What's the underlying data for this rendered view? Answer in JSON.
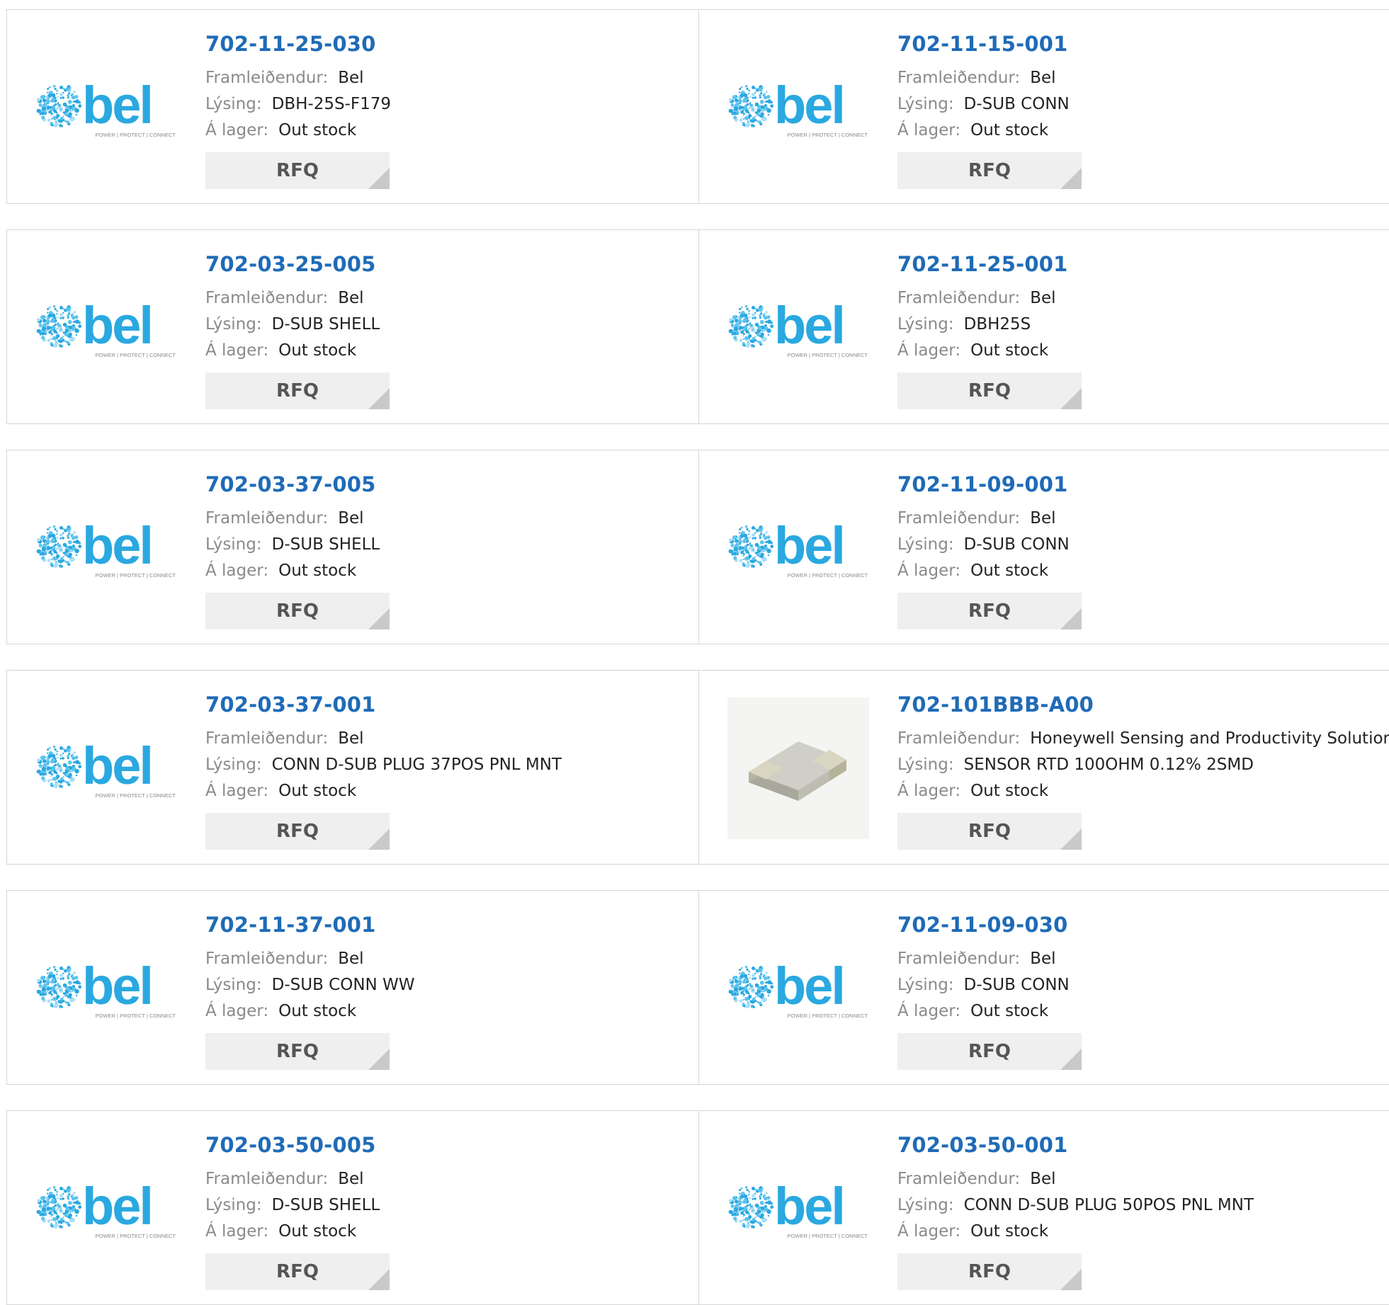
{
  "labels": {
    "manufacturer": "Framleiðendur:",
    "description": "Lýsing:",
    "stock": "Á lager:",
    "rfq": "RFQ"
  },
  "logo": {
    "text": "bel",
    "tagline": "POWER | PROTECT | CONNECT",
    "color": "#2aa8e0"
  },
  "colors": {
    "part_number": "#1f6bb7",
    "label": "#8a8a8a",
    "rfq_bg": "#efefef"
  },
  "products": [
    {
      "part_number": "702-11-25-030",
      "manufacturer": "Bel",
      "description": "DBH-25S-F179",
      "stock": "Out stock",
      "image": "bel-logo"
    },
    {
      "part_number": "702-11-15-001",
      "manufacturer": "Bel",
      "description": "D-SUB CONN",
      "stock": "Out stock",
      "image": "bel-logo"
    },
    {
      "part_number": "702-03-25-005",
      "manufacturer": "Bel",
      "description": "D-SUB SHELL",
      "stock": "Out stock",
      "image": "bel-logo"
    },
    {
      "part_number": "702-11-25-001",
      "manufacturer": "Bel",
      "description": "DBH25S",
      "stock": "Out stock",
      "image": "bel-logo"
    },
    {
      "part_number": "702-03-37-005",
      "manufacturer": "Bel",
      "description": "D-SUB SHELL",
      "stock": "Out stock",
      "image": "bel-logo"
    },
    {
      "part_number": "702-11-09-001",
      "manufacturer": "Bel",
      "description": "D-SUB CONN",
      "stock": "Out stock",
      "image": "bel-logo"
    },
    {
      "part_number": "702-03-37-001",
      "manufacturer": "Bel",
      "description": "CONN D-SUB PLUG 37POS PNL MNT",
      "stock": "Out stock",
      "image": "bel-logo"
    },
    {
      "part_number": "702-101BBB-A00",
      "manufacturer": "Honeywell Sensing and Productivity Solutions",
      "description": "SENSOR RTD 100OHM 0.12% 2SMD",
      "stock": "Out stock",
      "image": "smd-component"
    },
    {
      "part_number": "702-11-37-001",
      "manufacturer": "Bel",
      "description": "D-SUB CONN WW",
      "stock": "Out stock",
      "image": "bel-logo"
    },
    {
      "part_number": "702-11-09-030",
      "manufacturer": "Bel",
      "description": "D-SUB CONN",
      "stock": "Out stock",
      "image": "bel-logo"
    },
    {
      "part_number": "702-03-50-005",
      "manufacturer": "Bel",
      "description": "D-SUB SHELL",
      "stock": "Out stock",
      "image": "bel-logo"
    },
    {
      "part_number": "702-03-50-001",
      "manufacturer": "Bel",
      "description": "CONN D-SUB PLUG 50POS PNL MNT",
      "stock": "Out stock",
      "image": "bel-logo"
    }
  ]
}
